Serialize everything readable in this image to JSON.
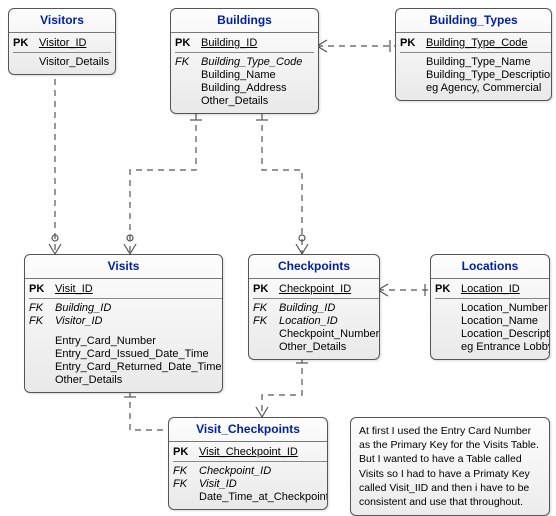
{
  "entities": {
    "visitors": {
      "title": "Visitors",
      "pk": {
        "label": "PK",
        "name": "Visitor_ID"
      },
      "rows": [
        {
          "key": "",
          "name": "Visitor_Details"
        }
      ]
    },
    "buildings": {
      "title": "Buildings",
      "pk": {
        "label": "PK",
        "name": "Building_ID"
      },
      "rows": [
        {
          "key": "FK",
          "name": "Building_Type_Code"
        },
        {
          "key": "",
          "name": "Building_Name"
        },
        {
          "key": "",
          "name": "Building_Address"
        },
        {
          "key": "",
          "name": "Other_Details"
        }
      ]
    },
    "building_types": {
      "title": "Building_Types",
      "pk": {
        "label": "PK",
        "name": "Building_Type_Code"
      },
      "rows": [
        {
          "key": "",
          "name": "Building_Type_Name"
        },
        {
          "key": "",
          "name": "Building_Type_Description"
        },
        {
          "key": "",
          "name": "eg Agency, Commercial"
        }
      ]
    },
    "visits": {
      "title": "Visits",
      "pk": {
        "label": "PK",
        "name": "Visit_ID"
      },
      "rows": [
        {
          "key": "FK",
          "name": "Building_ID"
        },
        {
          "key": "FK",
          "name": "Visitor_ID"
        },
        {
          "key": "",
          "name": "Entry_Card_Number",
          "gap": true
        },
        {
          "key": "",
          "name": "Entry_Card_Issued_Date_Time"
        },
        {
          "key": "",
          "name": "Entry_Card_Returned_Date_Time"
        },
        {
          "key": "",
          "name": "Other_Details"
        }
      ]
    },
    "checkpoints": {
      "title": "Checkpoints",
      "pk": {
        "label": "PK",
        "name": "Checkpoint_ID"
      },
      "rows": [
        {
          "key": "FK",
          "name": "Building_ID"
        },
        {
          "key": "FK",
          "name": "Location_ID"
        },
        {
          "key": "",
          "name": "Checkpoint_Number"
        },
        {
          "key": "",
          "name": "Other_Details"
        }
      ]
    },
    "locations": {
      "title": "Locations",
      "pk": {
        "label": "PK",
        "name": "Location_ID"
      },
      "rows": [
        {
          "key": "",
          "name": "Location_Number"
        },
        {
          "key": "",
          "name": "Location_Name"
        },
        {
          "key": "",
          "name": "Location_Description"
        },
        {
          "key": "",
          "name": "eg Entrance Lobby"
        }
      ]
    },
    "visit_checkpoints": {
      "title": "Visit_Checkpoints",
      "pk": {
        "label": "PK",
        "name": "Visit_Checkpoint_ID"
      },
      "rows": [
        {
          "key": "FK",
          "name": "Checkpoint_ID"
        },
        {
          "key": "FK",
          "name": "Visit_ID"
        },
        {
          "key": "",
          "name": "Date_Time_at_Checkpoint"
        }
      ]
    }
  },
  "note": {
    "text": "At first I used the Entry Card Number as the Primary Key for the Visits Table. But I wanted to have a Table called Visits so I had to have a Primaty Key called Visit_IID and then i have to be consistent and use that throughout."
  }
}
